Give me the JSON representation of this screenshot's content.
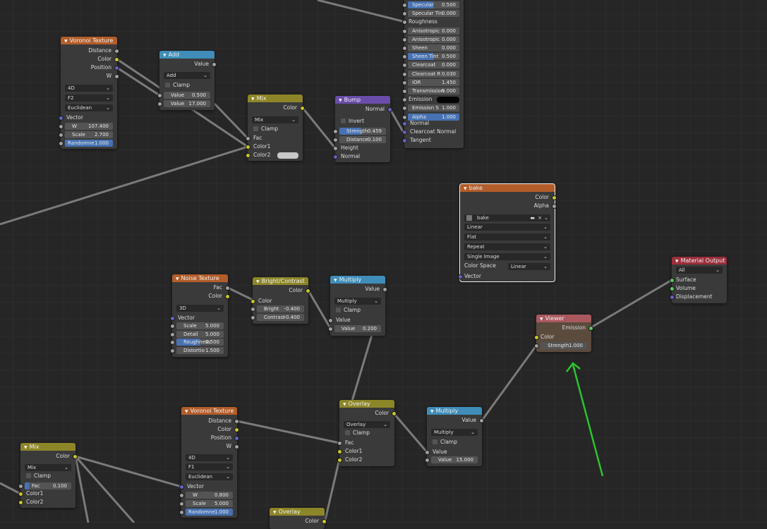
{
  "nodes": {
    "voronoi1": {
      "title": "Voronoi Texture",
      "outputs": [
        "Distance",
        "Color",
        "Position",
        "W"
      ],
      "dims": "4D",
      "feature": "F2",
      "metric": "Euclidean",
      "vector": "Vector",
      "w_label": "W",
      "w_val": "107.400",
      "scale_label": "Scale",
      "scale_val": "2.700",
      "rand_label": "Randomne",
      "rand_val": "1.000"
    },
    "add": {
      "title": "Add",
      "output": "Value",
      "op": "Add",
      "clamp": "Clamp",
      "v1_label": "Value",
      "v1": "0.500",
      "v2_label": "Value",
      "v2": "17.000"
    },
    "mix1": {
      "title": "Mix",
      "output": "Color",
      "mode": "Mix",
      "clamp": "Clamp",
      "fac": "Fac",
      "c1": "Color1",
      "c2": "Color2"
    },
    "bump": {
      "title": "Bump",
      "output": "Normal",
      "invert": "Invert",
      "strength_label": "Strength",
      "strength": "0.459",
      "distance_label": "Distance",
      "distance": "0.100",
      "height": "Height",
      "normal": "Normal"
    },
    "bsdf": {
      "rows": [
        {
          "label": "Specular",
          "val": "0.500",
          "hi": true
        },
        {
          "label": "Specular Tin",
          "val": "0.000",
          "hi": false
        },
        {
          "label": "Roughness",
          "val": "",
          "hi": false
        },
        {
          "label": "Anisotropic",
          "val": "0.000",
          "hi": false
        },
        {
          "label": "Anisotropic",
          "val": "0.000",
          "hi": false
        },
        {
          "label": "Sheen",
          "val": "0.000",
          "hi": false
        },
        {
          "label": "Sheen Tint",
          "val": "0.500",
          "hi": true
        },
        {
          "label": "Clearcoat",
          "val": "0.000",
          "hi": false
        },
        {
          "label": "Clearcoat R",
          "val": "0.030",
          "hi": false
        },
        {
          "label": "IOR",
          "val": "1.450",
          "hi": false
        },
        {
          "label": "Transmission",
          "val": "0.000",
          "hi": false
        },
        {
          "label": "Emission",
          "val": "",
          "hi": false
        },
        {
          "label": "Emission S",
          "val": "1.000",
          "hi": false
        },
        {
          "label": "Alpha",
          "val": "1.000",
          "hi": true
        }
      ],
      "normal": "Normal",
      "clearcoat_normal": "Clearcoat Normal",
      "tangent": "Tangent"
    },
    "bake": {
      "title": "bake",
      "color": "Color",
      "alpha": "Alpha",
      "image": "bake",
      "interp": "Linear",
      "proj": "Flat",
      "ext": "Repeat",
      "source": "Single Image",
      "cs_label": "Color Space",
      "cs": "Linear",
      "vector": "Vector"
    },
    "matout": {
      "title": "Material Output",
      "target": "All",
      "surface": "Surface",
      "volume": "Volume",
      "displacement": "Displacement"
    },
    "viewer": {
      "title": "Viewer",
      "emission": "Emission",
      "color": "Color",
      "strength_label": "Strength",
      "strength": "1.000"
    },
    "noise": {
      "title": "Noise Texture",
      "fac": "Fac",
      "color": "Color",
      "dims": "3D",
      "vector": "Vector",
      "scale_label": "Scale",
      "scale": "5.000",
      "detail_label": "Detail",
      "detail": "5.000",
      "rough_label": "Roughness",
      "rough": "0.500",
      "dist_label": "Distortio",
      "dist": "1.500"
    },
    "bright": {
      "title": "Bright/Contrast",
      "output": "Color",
      "color": "Color",
      "bright_label": "Bright",
      "bright": "-0.400",
      "contrast_label": "Contrast",
      "contrast": "-0.400"
    },
    "mult1": {
      "title": "Multiply",
      "output": "Value",
      "op": "Multiply",
      "clamp": "Clamp",
      "value": "Value",
      "v_label": "Value",
      "v": "0.200"
    },
    "overlay1": {
      "title": "Overlay",
      "output": "Color",
      "mode": "Overlay",
      "clamp": "Clamp",
      "fac": "Fac",
      "c1": "Color1",
      "c2": "Color2"
    },
    "mult2": {
      "title": "Multiply",
      "output": "Value",
      "op": "Multiply",
      "clamp": "Clamp",
      "value": "Value",
      "v_label": "Value",
      "v": "15.000"
    },
    "voronoi2": {
      "title": "Voronoi Texture",
      "outputs": [
        "Distance",
        "Color",
        "Position",
        "W"
      ],
      "dims": "4D",
      "feature": "F1",
      "metric": "Euclidean",
      "vector": "Vector",
      "w_label": "W",
      "w_val": "0.800",
      "scale_label": "Scale",
      "scale_val": "5.000",
      "rand_label": "Randomne",
      "rand_val": "1.000"
    },
    "mix2": {
      "title": "Mix",
      "output": "Color",
      "mode": "Mix",
      "clamp": "Clamp",
      "fac_label": "Fac",
      "fac": "0.100",
      "c1": "Color1",
      "c2": "Color2"
    },
    "overlay2": {
      "title": "Overlay",
      "output": "Color"
    }
  },
  "colors": {
    "annotation_arrow": "#2bc42b",
    "texture_header": "#b35d2a",
    "converter_header": "#3f8db8",
    "color_header": "#8d8628",
    "vector_header": "#6a4dab",
    "output_header": "#9b2f3b"
  }
}
